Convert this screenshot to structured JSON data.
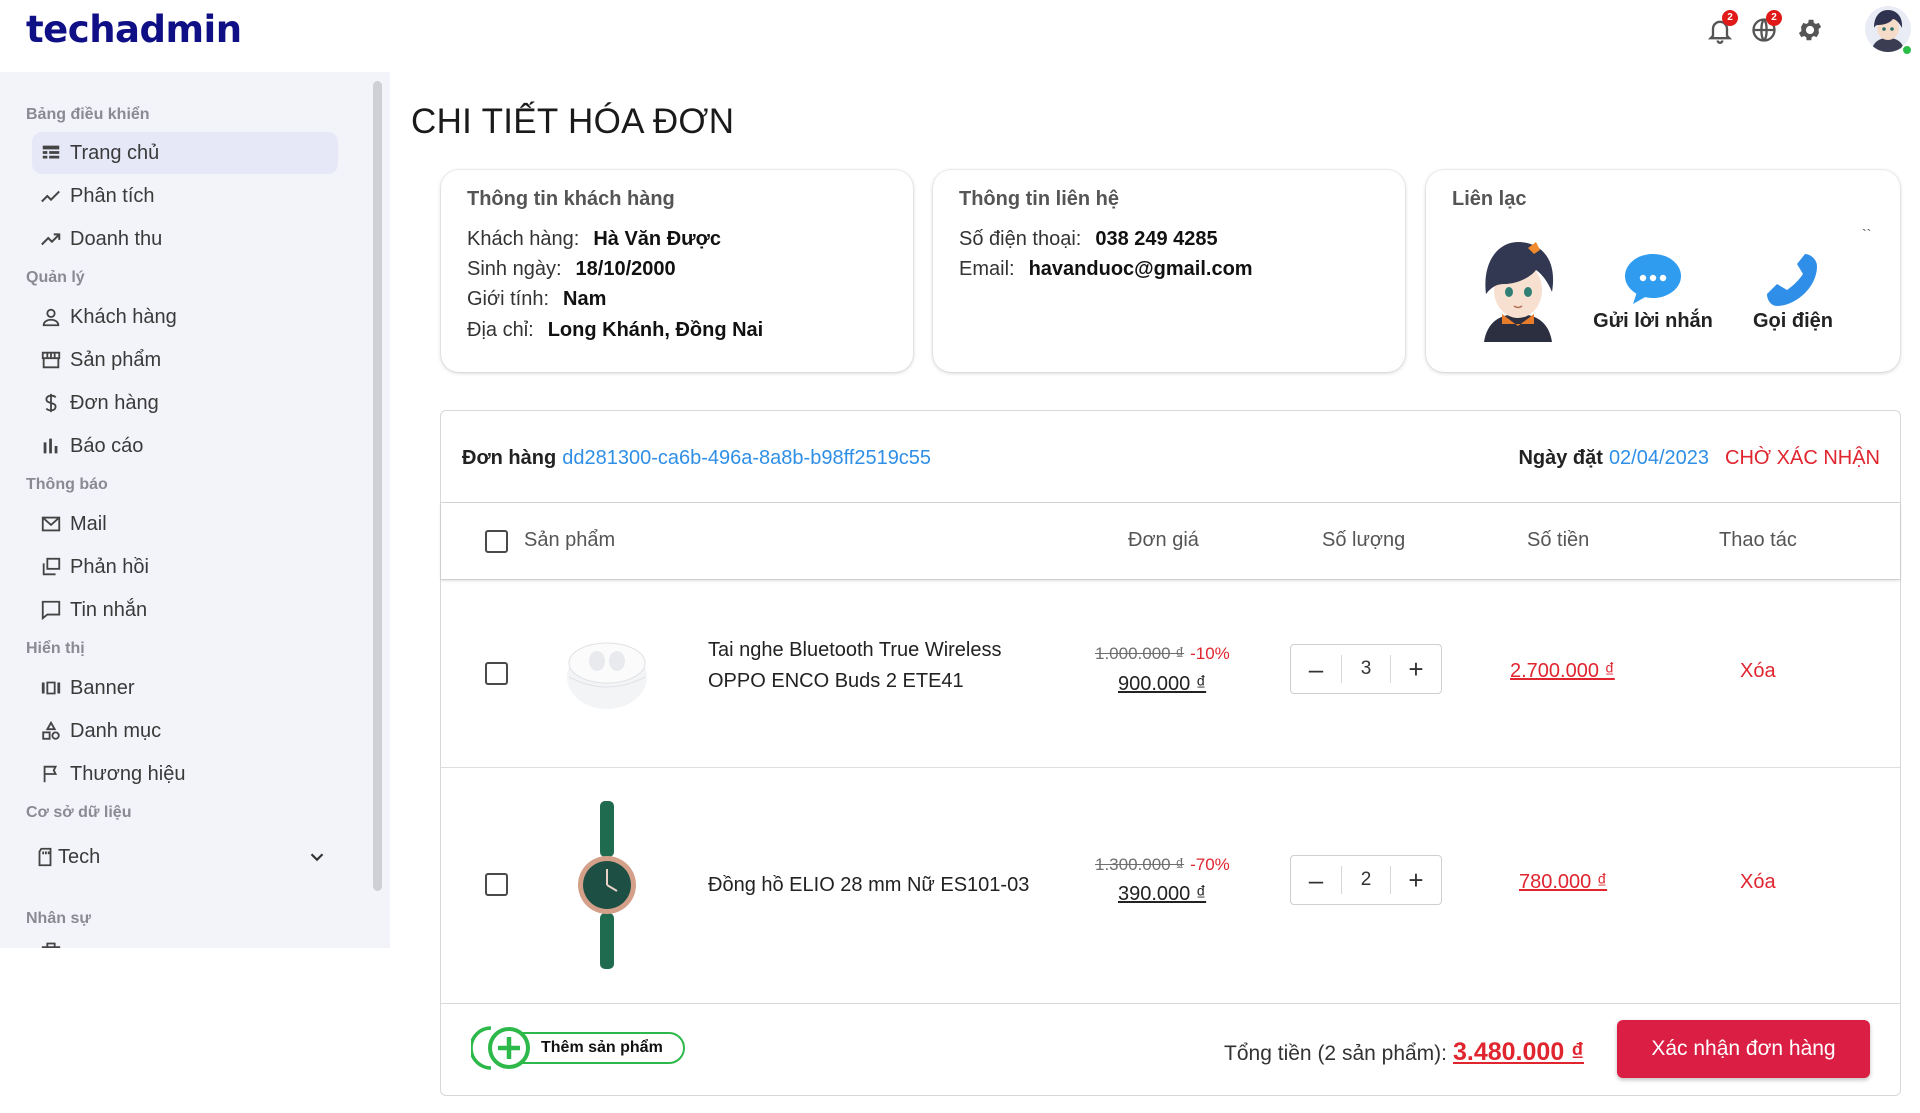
{
  "app": {
    "brand": "techadmin"
  },
  "header": {
    "notifications_count": "2",
    "language_count": "2"
  },
  "sidebar": {
    "sections": [
      {
        "title": "Bảng điều khiển",
        "items": [
          {
            "label": "Trang chủ",
            "icon": "dashboard-icon"
          },
          {
            "label": "Phân tích",
            "icon": "trend-icon"
          },
          {
            "label": "Doanh thu",
            "icon": "trend-up-icon"
          }
        ]
      },
      {
        "title": "Quản lý",
        "items": [
          {
            "label": "Khách hàng",
            "icon": "user-icon"
          },
          {
            "label": "Sản phẩm",
            "icon": "store-icon"
          },
          {
            "label": "Đơn hàng",
            "icon": "dollar-icon"
          },
          {
            "label": "Báo cáo",
            "icon": "bar-chart-icon"
          }
        ]
      },
      {
        "title": "Thông báo",
        "items": [
          {
            "label": "Mail",
            "icon": "mail-icon"
          },
          {
            "label": "Phản hồi",
            "icon": "feedback-icon"
          },
          {
            "label": "Tin nhắn",
            "icon": "message-icon"
          }
        ]
      },
      {
        "title": "Hiển thị",
        "items": [
          {
            "label": "Banner",
            "icon": "banner-icon"
          },
          {
            "label": "Danh mục",
            "icon": "category-icon"
          },
          {
            "label": "Thương hiệu",
            "icon": "flag-icon"
          }
        ]
      },
      {
        "title": "Cơ sở dữ liệu",
        "items": [
          {
            "label": "Tech",
            "icon": "sd-card-icon"
          }
        ]
      },
      {
        "title": "Nhân sự",
        "items": []
      }
    ]
  },
  "page": {
    "title": "CHI TIẾT HÓA ĐƠN"
  },
  "customer_card": {
    "title": "Thông tin khách hàng",
    "rows": [
      {
        "label": "Khách hàng:",
        "value": "Hà Văn Được"
      },
      {
        "label": "Sinh ngày:",
        "value": "18/10/2000"
      },
      {
        "label": "Giới tính:",
        "value": "Nam"
      },
      {
        "label": "Địa chỉ:",
        "value": "Long Khánh, Đồng Nai"
      }
    ]
  },
  "contact_card": {
    "title": "Thông tin liên hệ",
    "rows": [
      {
        "label": "Số điện thoại:",
        "value": "038 249 4285"
      },
      {
        "label": "Email:",
        "value": "havanduoc@gmail.com"
      }
    ]
  },
  "reach_card": {
    "title": "Liên lạc",
    "corner_mark": "``",
    "message_label": "Gửi lời nhắn",
    "call_label": "Gọi điện"
  },
  "order": {
    "label": "Đơn hàng",
    "code": "dd281300-ca6b-496a-8a8b-b98ff2519c55",
    "date_label": "Ngày đặt",
    "date": "02/04/2023",
    "status": "CHỜ XÁC NHẬN",
    "columns": [
      "Sản phẩm",
      "Đơn giá",
      "Số lượng",
      "Số tiền",
      "Thao tác"
    ],
    "items": [
      {
        "name_line1": "Tai nghe Bluetooth True Wireless",
        "name_line2": "OPPO ENCO Buds 2 ETE41",
        "price_old": "1.000.000 ₫",
        "discount": "-10%",
        "price_new": "900.000 ₫",
        "quantity": "3",
        "amount": "2.700.000 ₫",
        "action": "Xóa"
      },
      {
        "name_line1": "Đồng hồ ELIO 28 mm Nữ ES101-03",
        "name_line2": "",
        "price_old": "1.300.000 ₫",
        "discount": "-70%",
        "price_new": "390.000 ₫",
        "quantity": "2",
        "amount": "780.000 ₫",
        "action": "Xóa"
      }
    ],
    "qty_minus": "–",
    "qty_plus": "+",
    "add_product": "Thêm sản phẩm",
    "total_label": "Tổng tiền (2 sản phẩm):",
    "total_value": "3.480.000 ₫",
    "confirm_label": "Xác nhận đơn hàng"
  },
  "colors": {
    "brand": "#0f0f86",
    "accent_red": "#e0252f",
    "confirm_bg": "#db1f44",
    "link_blue": "#2f8fe6",
    "add_green": "#2db84a"
  }
}
